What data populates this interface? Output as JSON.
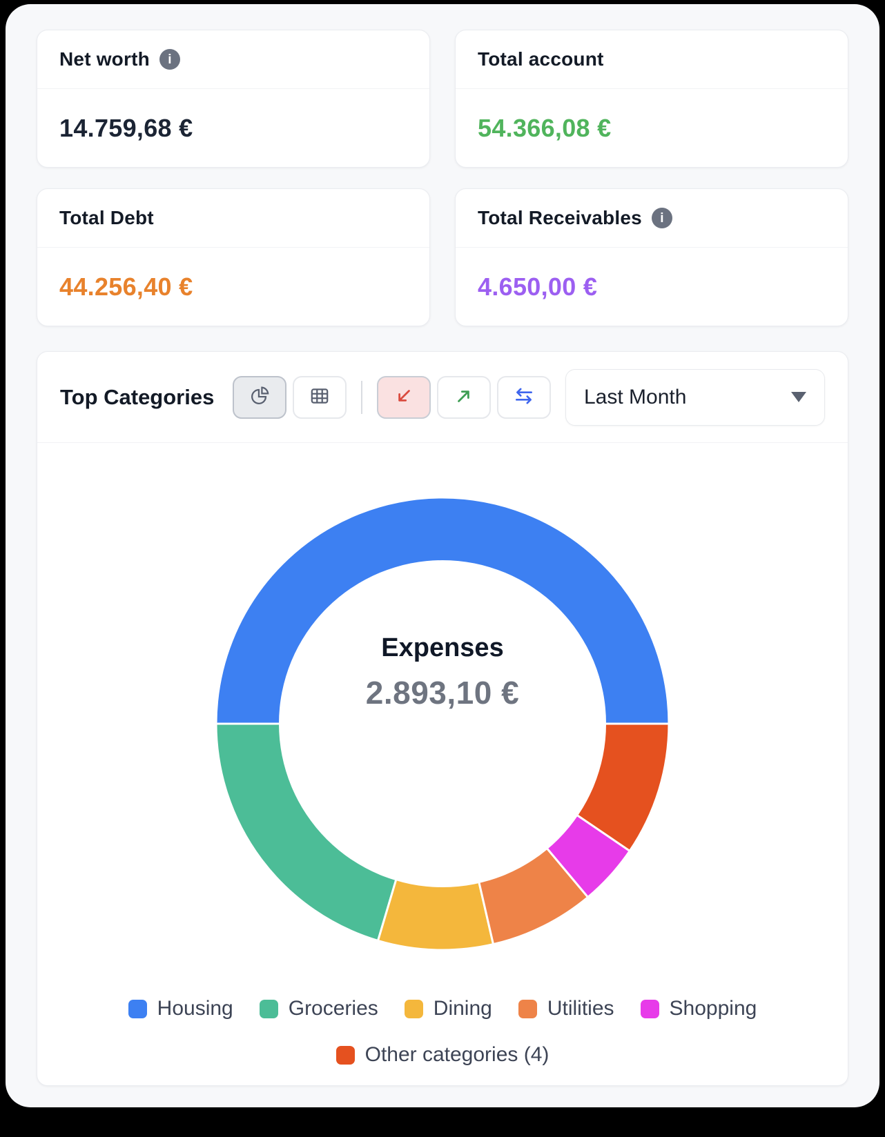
{
  "cards": [
    {
      "title": "Net worth",
      "value": "14.759,68 €",
      "value_color": "#1B2434",
      "has_info": true
    },
    {
      "title": "Total account",
      "value": "54.366,08 €",
      "value_color": "#50B45C",
      "has_info": false
    },
    {
      "title": "Total Debt",
      "value": "44.256,40 €",
      "value_color": "#E8822C",
      "has_info": false
    },
    {
      "title": "Total Receivables",
      "value": "4.650,00 €",
      "value_color": "#9C5FF1",
      "has_info": true
    }
  ],
  "top_categories": {
    "title": "Top Categories",
    "toolbar": {
      "icons": [
        "pie-chart",
        "table",
        "expenses-arrow-down-left",
        "income-arrow-up-right",
        "transfer-arrows"
      ],
      "active_view": "pie-chart",
      "active_flow": "expenses"
    },
    "period_selector": {
      "value": "Last Month",
      "icon": "caret-down"
    }
  },
  "chart_data": {
    "type": "pie",
    "donut": true,
    "title": "Top Categories",
    "center_label": "Expenses",
    "center_value": "2.893,10 €",
    "legend_position": "bottom",
    "series": [
      {
        "name": "Housing",
        "percent": 50.0,
        "color": "#3D80F2"
      },
      {
        "name": "Groceries",
        "percent": 20.4,
        "color": "#4CBD97"
      },
      {
        "name": "Dining",
        "percent": 8.2,
        "color": "#F4B73C"
      },
      {
        "name": "Utilities",
        "percent": 7.5,
        "color": "#EE8348"
      },
      {
        "name": "Shopping",
        "percent": 4.4,
        "color": "#E73BE9"
      },
      {
        "name": "Other categories (4)",
        "percent": 9.5,
        "color": "#E5511F"
      }
    ]
  },
  "colors": {
    "app_background": "#F7F8FA",
    "accent_blue": "#3F66EE",
    "positive_green": "#50B45C",
    "debt_orange": "#E8822C",
    "receivable_purple": "#9C5FF1"
  }
}
